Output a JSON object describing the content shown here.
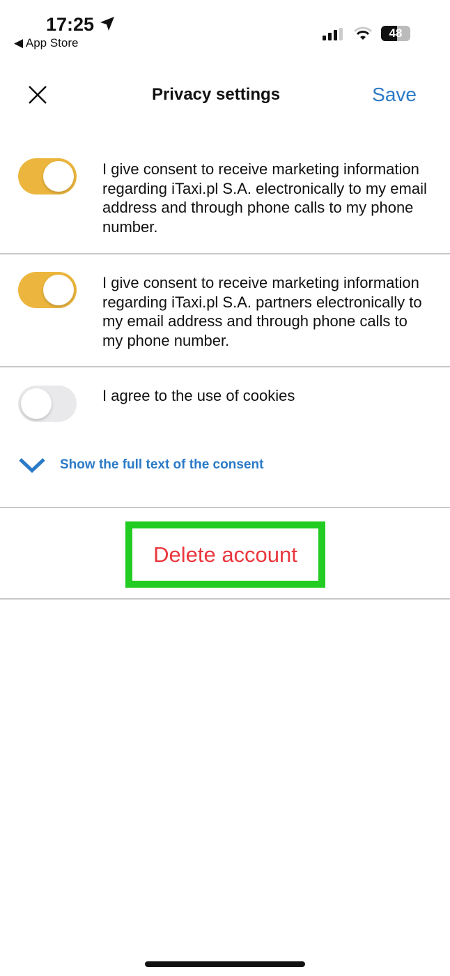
{
  "status_bar": {
    "time": "17:25",
    "back_label": "◀ App Store",
    "battery": "48",
    "icons": [
      "location-arrow-icon",
      "signal-icon",
      "wifi-icon",
      "battery-icon"
    ]
  },
  "header": {
    "title": "Privacy settings",
    "save_label": "Save",
    "close_icon": "close-icon"
  },
  "consents": [
    {
      "text": "I give consent to receive marketing information regarding iTaxi.pl S.A. electronically to my email address and through phone calls to my phone number.",
      "enabled": true
    },
    {
      "text": "I give consent to receive marketing information regarding iTaxi.pl S.A. partners electronically to my email address and through phone calls to my phone number.",
      "enabled": true
    },
    {
      "text": "I agree to the use of cookies",
      "enabled": false
    }
  ],
  "show_full_text_label": "Show the full text of the consent",
  "delete_account_label": "Delete account",
  "colors": {
    "accent": "#2a7ac7",
    "toggle_on": "#ecb63e",
    "danger": "#e8373d",
    "highlight": "#22cc22"
  }
}
